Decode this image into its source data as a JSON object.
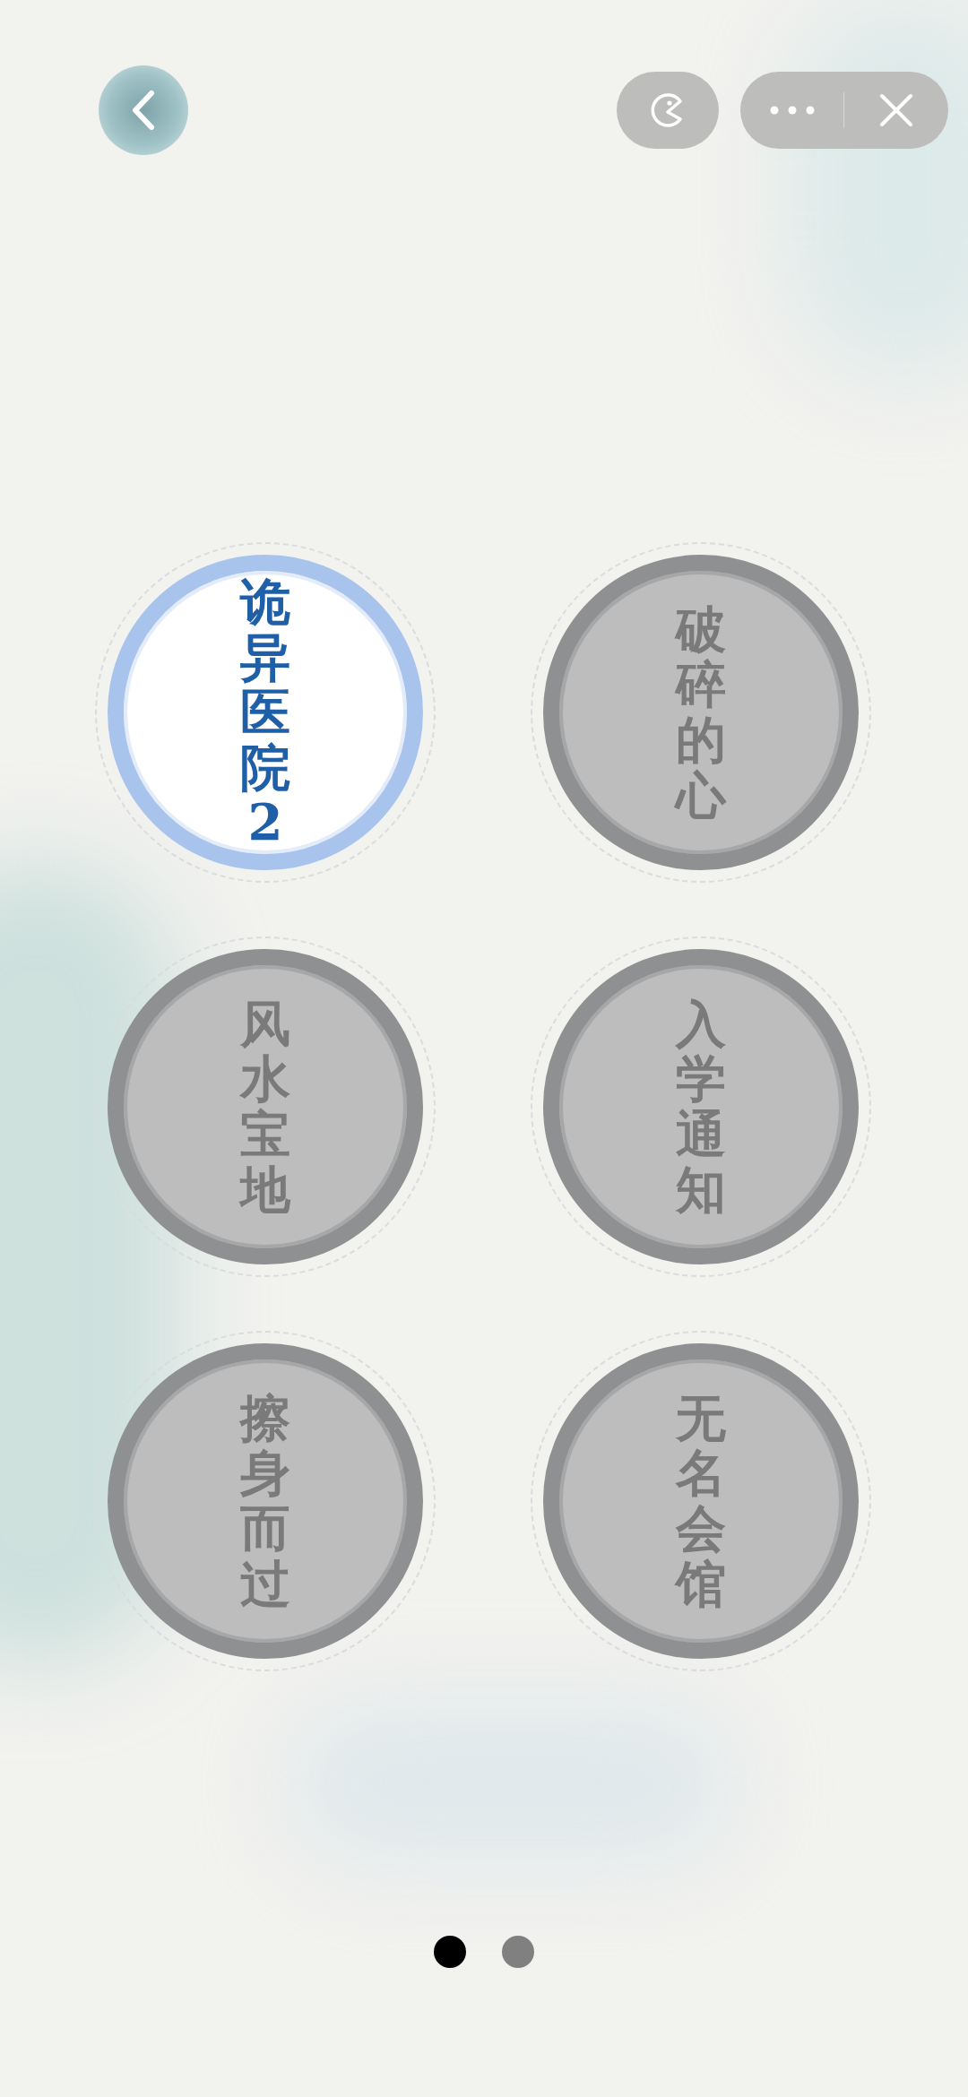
{
  "levels": [
    {
      "title": "诡异医院2",
      "selected": true
    },
    {
      "title": "破碎的心",
      "selected": false
    },
    {
      "title": "风水宝地",
      "selected": false
    },
    {
      "title": "入学通知",
      "selected": false
    },
    {
      "title": "擦身而过",
      "selected": false
    },
    {
      "title": "无名会馆",
      "selected": false
    }
  ],
  "pages": [
    {
      "selected": true
    },
    {
      "selected": false
    }
  ]
}
